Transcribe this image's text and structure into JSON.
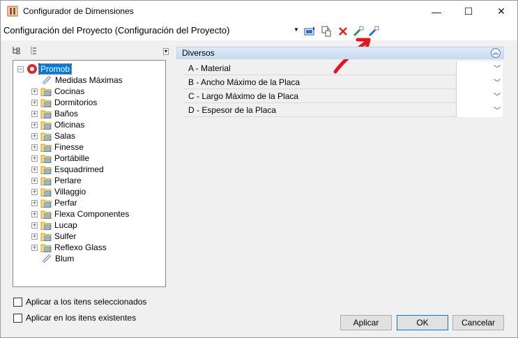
{
  "window": {
    "title": "Configurador de Dimensiones",
    "minimize": "—",
    "maximize": "☐",
    "close": "✕"
  },
  "project": {
    "selected": "Configuración del Proyecto (Configuración del Proyecto)"
  },
  "tree": {
    "root": "Promob",
    "items": [
      "Medidas Máximas",
      "Cocinas",
      "Dormitorios",
      "Baños",
      "Oficinas",
      "Salas",
      "Finesse",
      "Portábille",
      "Esquadrimed",
      "Perlare",
      "Villaggio",
      "Perfar",
      "Flexa Componentes",
      "Lucap",
      "Sulfer",
      "Reflexo Glass",
      "Blum"
    ]
  },
  "options": {
    "apply_selected": "Aplicar a los itens seleccionados",
    "apply_existing": "Aplicar en los itens existentes"
  },
  "properties": {
    "group": "Diversos",
    "rows": [
      {
        "label": "A - Material",
        "value": ""
      },
      {
        "label": "B -  Ancho Máximo de la Placa",
        "value": ""
      },
      {
        "label": "C - Largo Máximo de la Placa",
        "value": ""
      },
      {
        "label": "D - Espesor de la Placa",
        "value": ""
      }
    ]
  },
  "buttons": {
    "apply": "Aplicar",
    "ok": "OK",
    "cancel": "Cancelar"
  },
  "colors": {
    "annotation_arrow": "#e8141b",
    "selection": "#0078d7"
  }
}
